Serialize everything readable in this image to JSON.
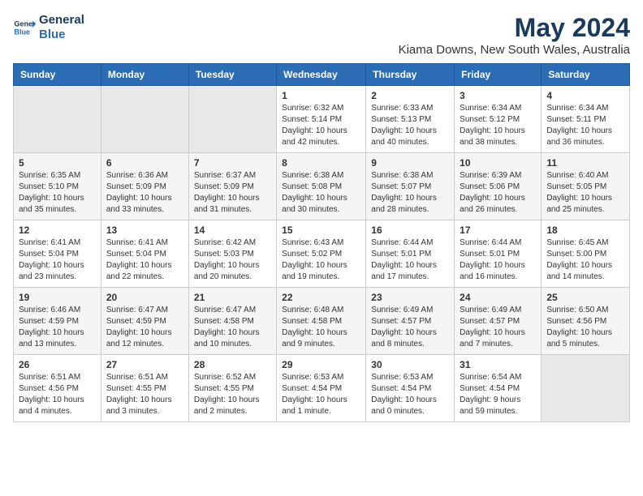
{
  "logo": {
    "line1": "General",
    "line2": "Blue"
  },
  "title": "May 2024",
  "subtitle": "Kiama Downs, New South Wales, Australia",
  "days_header": [
    "Sunday",
    "Monday",
    "Tuesday",
    "Wednesday",
    "Thursday",
    "Friday",
    "Saturday"
  ],
  "weeks": [
    [
      {
        "day": "",
        "info": ""
      },
      {
        "day": "",
        "info": ""
      },
      {
        "day": "",
        "info": ""
      },
      {
        "day": "1",
        "info": "Sunrise: 6:32 AM\nSunset: 5:14 PM\nDaylight: 10 hours\nand 42 minutes."
      },
      {
        "day": "2",
        "info": "Sunrise: 6:33 AM\nSunset: 5:13 PM\nDaylight: 10 hours\nand 40 minutes."
      },
      {
        "day": "3",
        "info": "Sunrise: 6:34 AM\nSunset: 5:12 PM\nDaylight: 10 hours\nand 38 minutes."
      },
      {
        "day": "4",
        "info": "Sunrise: 6:34 AM\nSunset: 5:11 PM\nDaylight: 10 hours\nand 36 minutes."
      }
    ],
    [
      {
        "day": "5",
        "info": "Sunrise: 6:35 AM\nSunset: 5:10 PM\nDaylight: 10 hours\nand 35 minutes."
      },
      {
        "day": "6",
        "info": "Sunrise: 6:36 AM\nSunset: 5:09 PM\nDaylight: 10 hours\nand 33 minutes."
      },
      {
        "day": "7",
        "info": "Sunrise: 6:37 AM\nSunset: 5:09 PM\nDaylight: 10 hours\nand 31 minutes."
      },
      {
        "day": "8",
        "info": "Sunrise: 6:38 AM\nSunset: 5:08 PM\nDaylight: 10 hours\nand 30 minutes."
      },
      {
        "day": "9",
        "info": "Sunrise: 6:38 AM\nSunset: 5:07 PM\nDaylight: 10 hours\nand 28 minutes."
      },
      {
        "day": "10",
        "info": "Sunrise: 6:39 AM\nSunset: 5:06 PM\nDaylight: 10 hours\nand 26 minutes."
      },
      {
        "day": "11",
        "info": "Sunrise: 6:40 AM\nSunset: 5:05 PM\nDaylight: 10 hours\nand 25 minutes."
      }
    ],
    [
      {
        "day": "12",
        "info": "Sunrise: 6:41 AM\nSunset: 5:04 PM\nDaylight: 10 hours\nand 23 minutes."
      },
      {
        "day": "13",
        "info": "Sunrise: 6:41 AM\nSunset: 5:04 PM\nDaylight: 10 hours\nand 22 minutes."
      },
      {
        "day": "14",
        "info": "Sunrise: 6:42 AM\nSunset: 5:03 PM\nDaylight: 10 hours\nand 20 minutes."
      },
      {
        "day": "15",
        "info": "Sunrise: 6:43 AM\nSunset: 5:02 PM\nDaylight: 10 hours\nand 19 minutes."
      },
      {
        "day": "16",
        "info": "Sunrise: 6:44 AM\nSunset: 5:01 PM\nDaylight: 10 hours\nand 17 minutes."
      },
      {
        "day": "17",
        "info": "Sunrise: 6:44 AM\nSunset: 5:01 PM\nDaylight: 10 hours\nand 16 minutes."
      },
      {
        "day": "18",
        "info": "Sunrise: 6:45 AM\nSunset: 5:00 PM\nDaylight: 10 hours\nand 14 minutes."
      }
    ],
    [
      {
        "day": "19",
        "info": "Sunrise: 6:46 AM\nSunset: 4:59 PM\nDaylight: 10 hours\nand 13 minutes."
      },
      {
        "day": "20",
        "info": "Sunrise: 6:47 AM\nSunset: 4:59 PM\nDaylight: 10 hours\nand 12 minutes."
      },
      {
        "day": "21",
        "info": "Sunrise: 6:47 AM\nSunset: 4:58 PM\nDaylight: 10 hours\nand 10 minutes."
      },
      {
        "day": "22",
        "info": "Sunrise: 6:48 AM\nSunset: 4:58 PM\nDaylight: 10 hours\nand 9 minutes."
      },
      {
        "day": "23",
        "info": "Sunrise: 6:49 AM\nSunset: 4:57 PM\nDaylight: 10 hours\nand 8 minutes."
      },
      {
        "day": "24",
        "info": "Sunrise: 6:49 AM\nSunset: 4:57 PM\nDaylight: 10 hours\nand 7 minutes."
      },
      {
        "day": "25",
        "info": "Sunrise: 6:50 AM\nSunset: 4:56 PM\nDaylight: 10 hours\nand 5 minutes."
      }
    ],
    [
      {
        "day": "26",
        "info": "Sunrise: 6:51 AM\nSunset: 4:56 PM\nDaylight: 10 hours\nand 4 minutes."
      },
      {
        "day": "27",
        "info": "Sunrise: 6:51 AM\nSunset: 4:55 PM\nDaylight: 10 hours\nand 3 minutes."
      },
      {
        "day": "28",
        "info": "Sunrise: 6:52 AM\nSunset: 4:55 PM\nDaylight: 10 hours\nand 2 minutes."
      },
      {
        "day": "29",
        "info": "Sunrise: 6:53 AM\nSunset: 4:54 PM\nDaylight: 10 hours\nand 1 minute."
      },
      {
        "day": "30",
        "info": "Sunrise: 6:53 AM\nSunset: 4:54 PM\nDaylight: 10 hours\nand 0 minutes."
      },
      {
        "day": "31",
        "info": "Sunrise: 6:54 AM\nSunset: 4:54 PM\nDaylight: 9 hours\nand 59 minutes."
      },
      {
        "day": "",
        "info": ""
      }
    ]
  ]
}
